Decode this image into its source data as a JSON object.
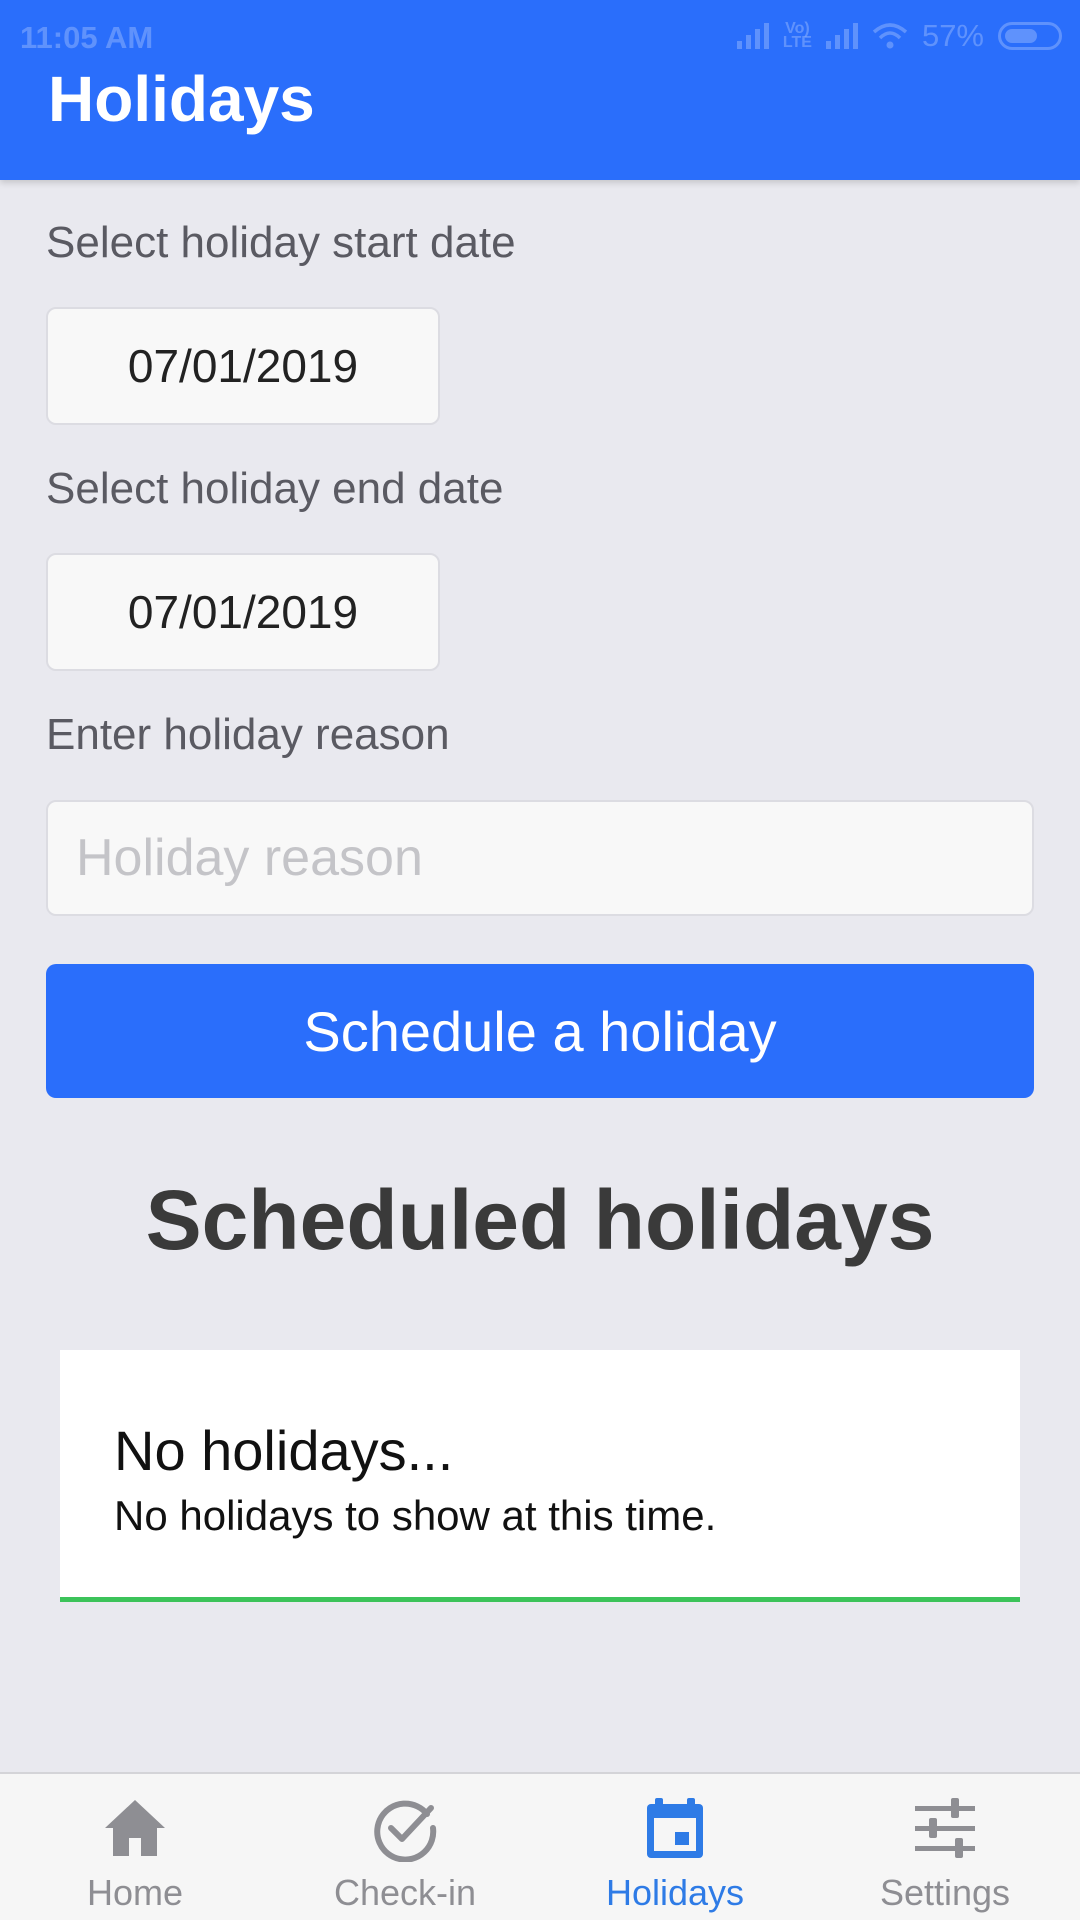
{
  "status_bar": {
    "time": "11:05 AM",
    "volte_top": "Vo)",
    "volte_bottom": "LTE",
    "battery": "57%"
  },
  "header": {
    "title": "Holidays"
  },
  "form": {
    "start_label": "Select holiday start date",
    "start_value": "07/01/2019",
    "end_label": "Select holiday end date",
    "end_value": "07/01/2019",
    "reason_label": "Enter holiday reason",
    "reason_placeholder": "Holiday reason",
    "reason_value": "",
    "submit_label": "Schedule a holiday"
  },
  "scheduled": {
    "title": "Scheduled holidays",
    "empty_title": "No holidays...",
    "empty_text": "No holidays to show at this time."
  },
  "tabs": [
    {
      "label": "Home",
      "icon": "home-icon",
      "active": false
    },
    {
      "label": "Check-in",
      "icon": "check-circle-icon",
      "active": false
    },
    {
      "label": "Holidays",
      "icon": "calendar-icon",
      "active": true
    },
    {
      "label": "Settings",
      "icon": "sliders-icon",
      "active": false
    }
  ],
  "colors": {
    "primary": "#2A6EFB",
    "background": "#E9E9EF",
    "tab_active": "#2E7BE6",
    "tab_inactive": "#8E8E93",
    "card_accent": "#3CC35A"
  }
}
